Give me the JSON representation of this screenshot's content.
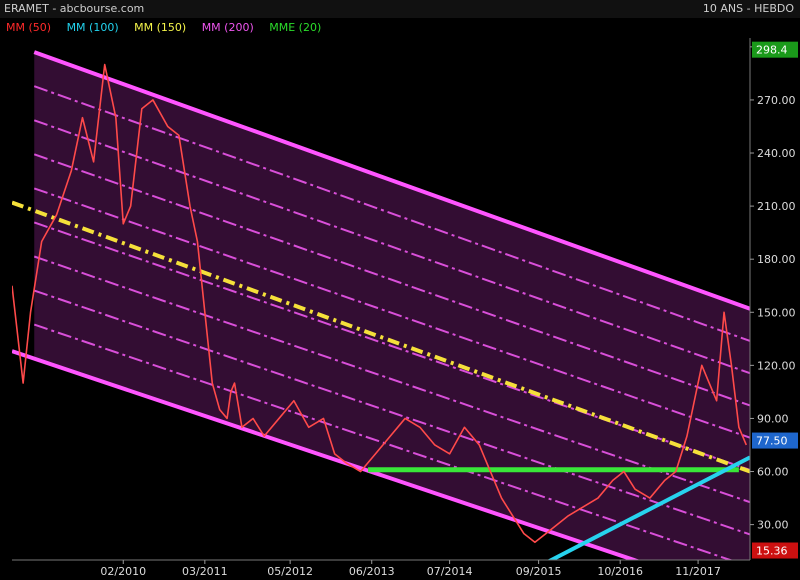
{
  "header": {
    "left": "ERAMET - abcbourse.com",
    "right": "10 ANS - HEBDO"
  },
  "legend": [
    {
      "label": "MM (50)",
      "color": "#ff2a2a"
    },
    {
      "label": "MM (100)",
      "color": "#22d3ee"
    },
    {
      "label": "MM (150)",
      "color": "#f5f54a"
    },
    {
      "label": "MM (200)",
      "color": "#ee55ee"
    },
    {
      "label": "MME (20)",
      "color": "#2bdd2b"
    }
  ],
  "chart_data": {
    "type": "line",
    "title": "",
    "xlabel": "",
    "ylabel": "",
    "ylim": [
      10,
      305
    ],
    "y_ticks": [
      30,
      60,
      90,
      120,
      150,
      180,
      210,
      240,
      270,
      300
    ],
    "y_tick_labels": [
      "30.00",
      "60.00",
      "90.00",
      "120.00",
      "150.00",
      "180.00",
      "210.00",
      "240.00",
      "270.00",
      "300.00"
    ],
    "x_range": [
      2008.6,
      2018.55
    ],
    "x_ticks": [
      {
        "label": "02/2010",
        "t": 2010.1
      },
      {
        "label": "03/2011",
        "t": 2011.2
      },
      {
        "label": "05/2012",
        "t": 2012.35
      },
      {
        "label": "06/2013",
        "t": 2013.45
      },
      {
        "label": "07/2014",
        "t": 2014.5
      },
      {
        "label": "09/2015",
        "t": 2015.7
      },
      {
        "label": "10/2016",
        "t": 2016.8
      },
      {
        "label": "11/2017",
        "t": 2017.85
      }
    ],
    "price_labels": [
      {
        "value": 298.4,
        "text": "298.4",
        "color": "#1a9a1a"
      },
      {
        "value": 77.5,
        "text": "77.50",
        "color": "#1e66cc"
      },
      {
        "value": 15.36,
        "text": "15.36",
        "color": "#cc1010"
      }
    ],
    "series": [
      {
        "name": "",
        "color": "#ff4a4a",
        "x": [
          2008.6,
          2008.75,
          2008.85,
          2009.0,
          2009.2,
          2009.4,
          2009.55,
          2009.7,
          2009.85,
          2010.0,
          2010.1,
          2010.2,
          2010.35,
          2010.5,
          2010.7,
          2010.85,
          2011.0,
          2011.1,
          2011.2,
          2011.3,
          2011.4,
          2011.5,
          2011.55,
          2011.6,
          2011.7,
          2011.85,
          2012.0,
          2012.2,
          2012.4,
          2012.6,
          2012.8,
          2012.95,
          2013.1,
          2013.3,
          2013.5,
          2013.7,
          2013.9,
          2014.1,
          2014.3,
          2014.5,
          2014.7,
          2014.9,
          2015.05,
          2015.2,
          2015.35,
          2015.5,
          2015.65,
          2015.8,
          2015.95,
          2016.1,
          2016.3,
          2016.5,
          2016.7,
          2016.85,
          2017.0,
          2017.2,
          2017.4,
          2017.55,
          2017.7,
          2017.8,
          2017.9,
          2018.0,
          2018.1,
          2018.2,
          2018.3,
          2018.4,
          2018.5
        ],
        "y": [
          165,
          110,
          150,
          190,
          205,
          230,
          260,
          235,
          290,
          260,
          200,
          210,
          265,
          270,
          255,
          250,
          210,
          190,
          150,
          110,
          95,
          90,
          105,
          110,
          85,
          90,
          80,
          90,
          100,
          85,
          90,
          70,
          65,
          60,
          70,
          80,
          90,
          85,
          75,
          70,
          85,
          75,
          60,
          45,
          35,
          25,
          20,
          25,
          30,
          35,
          40,
          45,
          55,
          60,
          50,
          45,
          55,
          60,
          80,
          100,
          120,
          110,
          100,
          150,
          120,
          85,
          75
        ]
      }
    ],
    "annotations": [
      {
        "type": "channel-top",
        "color": "#ff55ff",
        "from": [
          2008.9,
          297
        ],
        "to": [
          2018.55,
          152
        ]
      },
      {
        "type": "channel-bottom",
        "color": "#ff55ff",
        "from": [
          2008.6,
          128
        ],
        "to": [
          2018.55,
          -12
        ]
      },
      {
        "type": "median",
        "color": "#f5e03a",
        "from": [
          2008.6,
          212
        ],
        "to": [
          2018.55,
          60
        ]
      },
      {
        "type": "support",
        "color": "#39e639",
        "from": [
          2013.4,
          61
        ],
        "to": [
          2018.4,
          61
        ]
      },
      {
        "type": "trend",
        "color": "#27d3ee",
        "from": [
          2015.55,
          3
        ],
        "to": [
          2018.55,
          68
        ]
      }
    ]
  }
}
